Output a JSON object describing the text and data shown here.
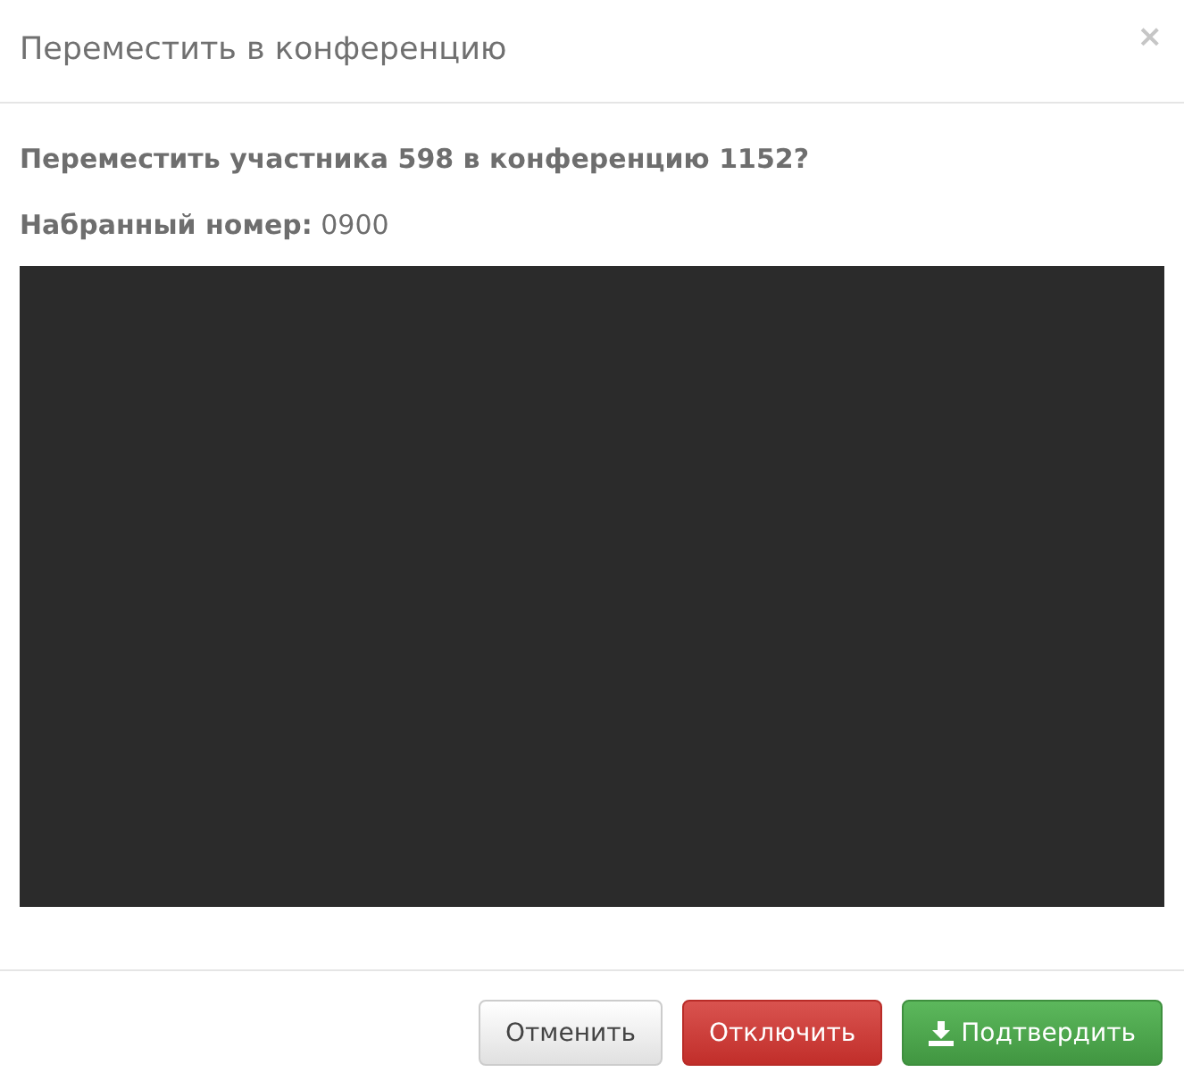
{
  "dialog": {
    "title": "Переместить в конференцию",
    "close": "×"
  },
  "body": {
    "question": "Переместить участника 598 в конференцию 1152?",
    "dialed": "**Набранный номер:** 0900"
  },
  "footer": {
    "buttons": [
      {
        "kind": "cancel",
        "label": "Отменить"
      },
      {
        "kind": "disconnect",
        "label": "Отключить"
      },
      {
        "kind": "confirm",
        "label": "Подтвердить"
      }
    ]
  }
}
